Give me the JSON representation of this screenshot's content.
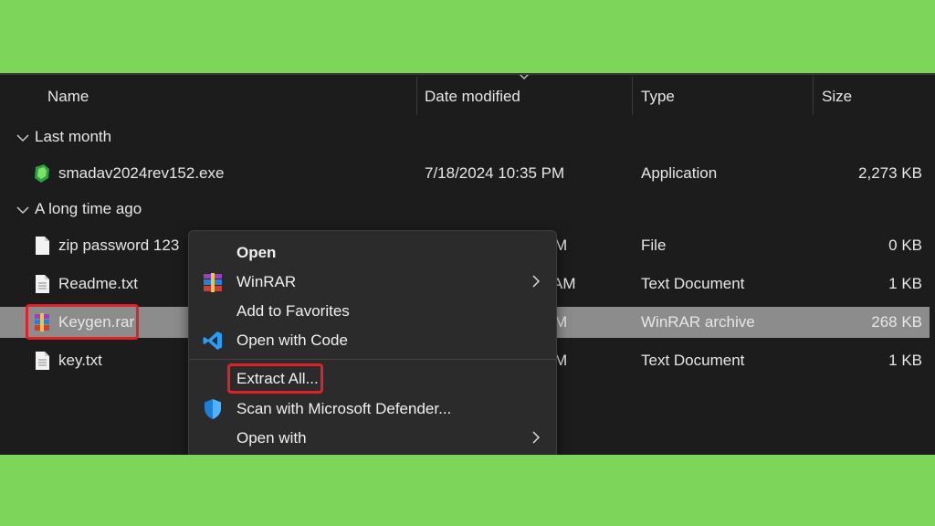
{
  "header": {
    "name": "Name",
    "date_modified": "Date modified",
    "type": "Type",
    "size": "Size"
  },
  "groups": [
    {
      "label": "Last month"
    },
    {
      "label": "A long time ago"
    }
  ],
  "files": [
    {
      "name": "smadav2024rev152.exe",
      "date": "7/18/2024 10:35 PM",
      "type": "Application",
      "size": "2,273 KB",
      "icon": "smadav-app-icon"
    },
    {
      "name": "zip password 123",
      "date": "M",
      "type": "File",
      "size": "0 KB",
      "icon": "file-icon"
    },
    {
      "name": "Readme.txt",
      "date": "AM",
      "type": "Text Document",
      "size": "1 KB",
      "icon": "text-document-icon"
    },
    {
      "name": "Keygen.rar",
      "date": "M",
      "type": "WinRAR archive",
      "size": "268 KB",
      "icon": "winrar-archive-icon",
      "selected": true
    },
    {
      "name": "key.txt",
      "date": "M",
      "type": "Text Document",
      "size": "1 KB",
      "icon": "text-document-icon"
    }
  ],
  "context_menu": {
    "items": [
      {
        "label": "Open",
        "bold": true
      },
      {
        "label": "WinRAR",
        "icon": "winrar-icon",
        "submenu": true
      },
      {
        "label": "Add to Favorites"
      },
      {
        "label": "Open with Code",
        "icon": "vscode-icon"
      },
      {
        "label": "Extract All..."
      },
      {
        "label": "Scan with Microsoft Defender...",
        "icon": "defender-shield-icon"
      },
      {
        "label": "Open with",
        "submenu": true
      }
    ]
  },
  "colors": {
    "background": "#7dd65a",
    "explorer_bg": "#1c1c1c",
    "selected_row": "#8c8c8c",
    "menu_bg": "#2b2b2b",
    "highlight_red": "#e0202a"
  }
}
